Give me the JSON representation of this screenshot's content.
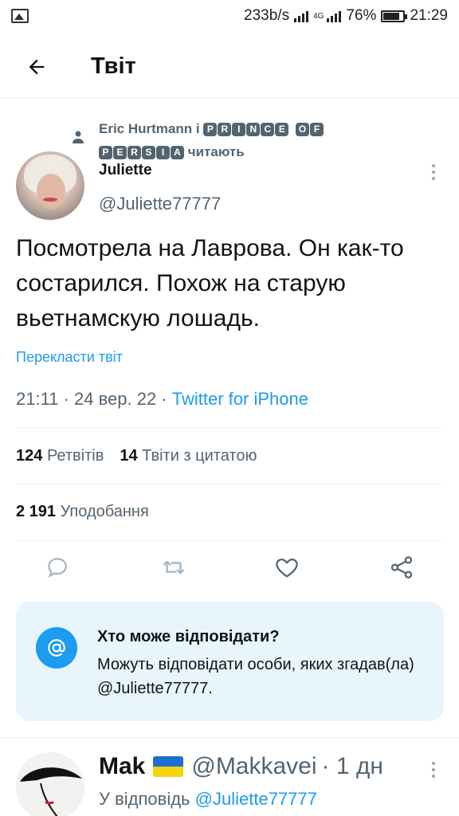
{
  "status_bar": {
    "speed": "233b/s",
    "network": "4G",
    "battery": "76%",
    "time": "21:29",
    "icons": [
      "gallery-icon",
      "signal-icon",
      "signal-4g-icon",
      "battery-icon"
    ]
  },
  "header": {
    "title": "Твіт",
    "back_icon": "arrow-left-icon"
  },
  "social_context": {
    "name": "Eric Hurtmann і",
    "boxed_line1_a": [
      "P",
      "R",
      "I",
      "N",
      "C",
      "E"
    ],
    "boxed_line1_b": [
      "O",
      "F"
    ],
    "boxed_line2": [
      "P",
      "E",
      "R",
      "S",
      "I",
      "A"
    ],
    "suffix": "читають",
    "icon": "person-icon"
  },
  "tweet": {
    "author_name": "Juliette",
    "author_handle": "@Juliette77777",
    "text": "Посмотрела на Лаврова.  Он как-то состарился.  Похож на старую вьетнамскую лошадь.",
    "translate_label": "Перекласти твіт",
    "time": "21:11",
    "date": "24 вер. 22",
    "source": "Twitter for iPhone",
    "retweets_count": "124",
    "retweets_label": "Ретвітів",
    "quotes_count": "14",
    "quotes_label": "Твіти з цитатою",
    "likes_count": "2 191",
    "likes_label": "Уподобання"
  },
  "actions": {
    "icons": [
      "reply-icon",
      "retweet-icon",
      "like-icon",
      "share-icon"
    ]
  },
  "reply_restriction": {
    "title": "Хто може відповідати?",
    "body": "Можуть відповідати особи, яких згадав(ла) @Juliette77777.",
    "icon": "at-sign-icon"
  },
  "reply": {
    "name": "Mak",
    "handle": "@Makkavei",
    "time_ago": "· 1 дн",
    "reply_to_label": "У відповідь",
    "reply_to_handle": "@Juliette77777",
    "flag_colors": [
      "#1f6fd1",
      "#f7d40d"
    ]
  },
  "colors": {
    "accent": "#1d9bf0",
    "muted_text": "#536471",
    "primary_text": "#0f1419",
    "card_background": "#e8f5fd"
  }
}
